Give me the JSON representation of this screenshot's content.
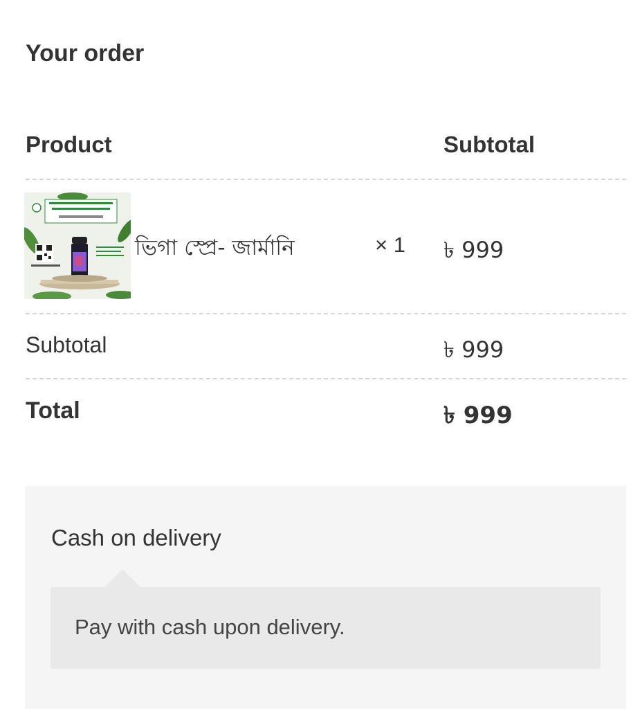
{
  "order": {
    "heading": "Your order",
    "columns": {
      "product": "Product",
      "subtotal": "Subtotal"
    },
    "items": [
      {
        "name": "ভিগা স্প্রে- জার্মানি",
        "quantity": "× 1",
        "price": "৳ 999"
      }
    ],
    "subtotal": {
      "label": "Subtotal",
      "value": "৳ 999"
    },
    "total": {
      "label": "Total",
      "value": "৳ 999"
    }
  },
  "payment": {
    "method_label": "Cash on delivery",
    "description": "Pay with cash upon delivery."
  },
  "colors": {
    "brand_green": "#2e8b3e",
    "panel_bg": "#f5f5f5",
    "desc_bg": "#e9e9e9"
  }
}
